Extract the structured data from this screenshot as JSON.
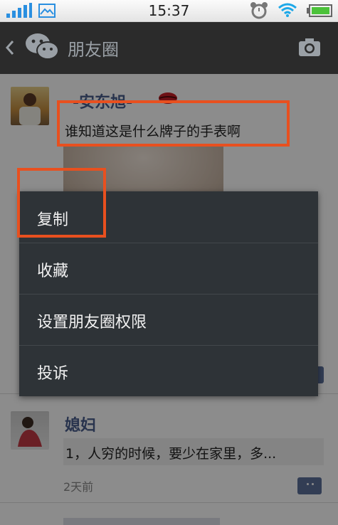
{
  "status_bar": {
    "time": "15:37"
  },
  "title_bar": {
    "title": "朋友圈"
  },
  "posts": [
    {
      "author": "-安东旭-",
      "text": "谁知道这是什么牌子的手表啊"
    },
    {
      "author": "媳妇",
      "text": "1，人穷的时候，要少在家里，多...",
      "time": "2天前"
    }
  ],
  "context_menu": {
    "items": [
      {
        "label": "复制"
      },
      {
        "label": "收藏"
      },
      {
        "label": "设置朋友圈权限"
      },
      {
        "label": "投诉"
      }
    ]
  },
  "colors": {
    "accent_link": "#4a5d8c",
    "highlight": "#e8501f",
    "menu_bg": "#2e3337",
    "wifi": "#1da8e8",
    "battery": "#4bc23a",
    "signal": "#2a8fe0"
  }
}
